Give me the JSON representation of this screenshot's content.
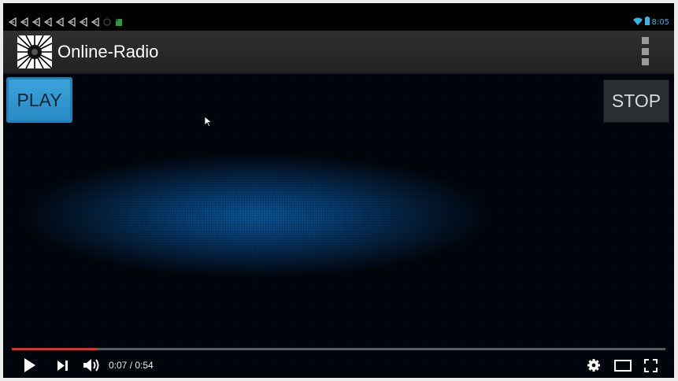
{
  "statusbar": {
    "notification_icons": [
      "back-arrow-icon",
      "back-arrow-icon",
      "back-arrow-icon",
      "back-arrow-icon",
      "back-arrow-icon",
      "back-arrow-icon",
      "back-arrow-icon",
      "back-arrow-icon",
      "sync-icon",
      "sd-card-icon"
    ],
    "time": "8:05",
    "accent_color": "#33b5e5"
  },
  "actionbar": {
    "title": "Online-Radio"
  },
  "content": {
    "play_label": "PLAY",
    "stop_label": "STOP"
  },
  "player": {
    "current_time": "0:07",
    "duration": "0:54",
    "time_display": "0:07 / 0:54",
    "progress_fraction": 0.13,
    "progress_color": "#e52d27"
  }
}
